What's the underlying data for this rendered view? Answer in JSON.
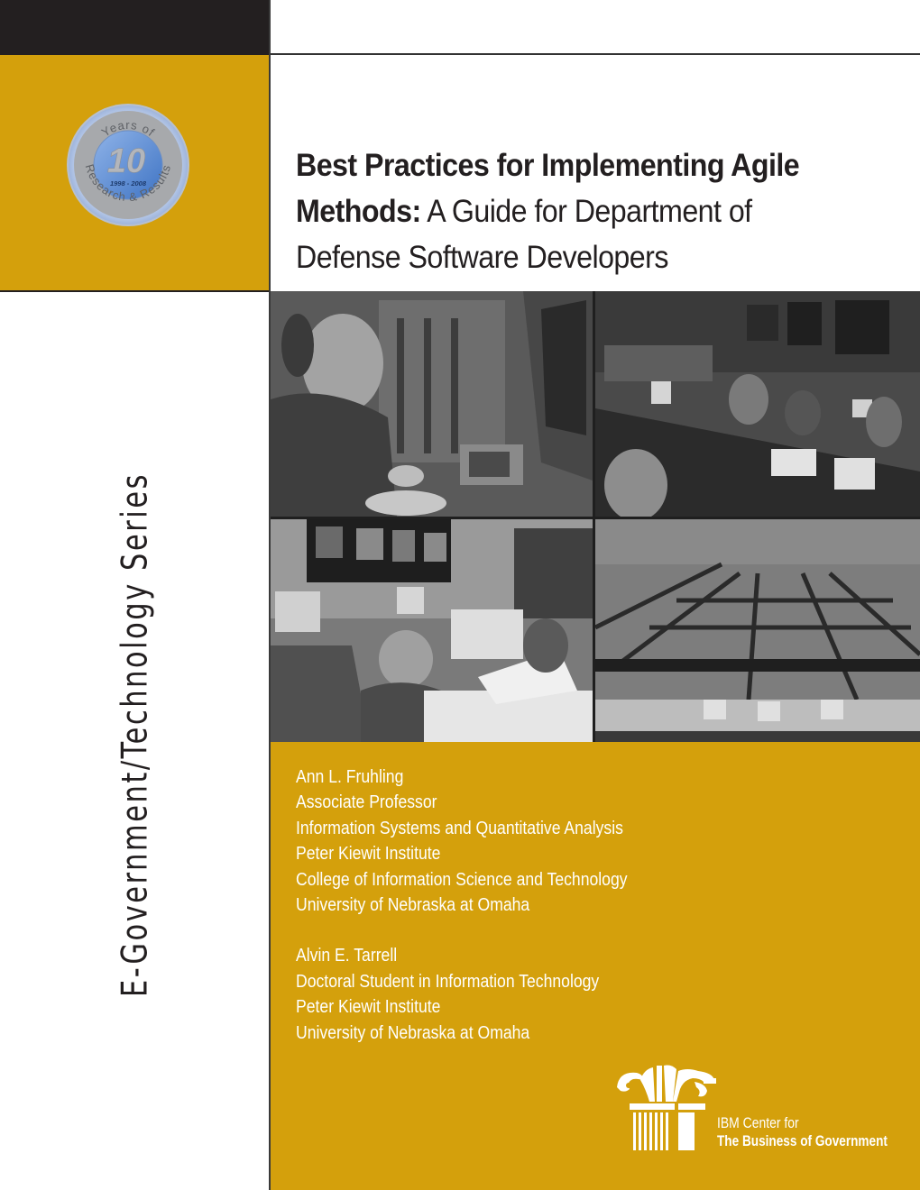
{
  "colors": {
    "gold": "#d4a00c",
    "black": "#231f20",
    "white": "#ffffff",
    "seal_blue": "#5b8fd6",
    "seal_gray": "#a7a9ac"
  },
  "seal": {
    "top_text": "Years of",
    "number": "10",
    "years": "1998 - 2008",
    "bottom_text": "Research & Results"
  },
  "title": {
    "bold_part": "Best Practices for Implementing Agile Methods:",
    "line1": "Best Practices for Implementing Agile",
    "line2_bold": "Methods:",
    "line2_light": " A Guide for Department of",
    "line3": "Defense Software Developers"
  },
  "series_label": "E-Government/Technology Series",
  "photos": [
    {
      "name": "operator-at-console",
      "description": "Airman wearing headset at radar console"
    },
    {
      "name": "command-center-briefing",
      "description": "Command center with screens and personnel at desks"
    },
    {
      "name": "operations-room-workstations",
      "description": "Personnel at computer workstations with wall monitors"
    },
    {
      "name": "hangar-facility-overview",
      "description": "Wide view of large facility with cubicles and steel beams"
    }
  ],
  "authors": [
    {
      "name": "Ann L. Fruhling",
      "lines": [
        "Associate Professor",
        "Information Systems and Quantitative Analysis",
        "Peter Kiewit Institute",
        "College of Information Science and Technology",
        "University of Nebraska at Omaha"
      ]
    },
    {
      "name": "Alvin E. Tarrell",
      "lines": [
        "Doctoral Student in Information Technology",
        "Peter Kiewit Institute",
        "University of Nebraska at Omaha"
      ]
    }
  ],
  "publisher": {
    "line1": "IBM Center for",
    "line2": "The Business of Government",
    "logo_icon": "ionic-column-icon"
  }
}
